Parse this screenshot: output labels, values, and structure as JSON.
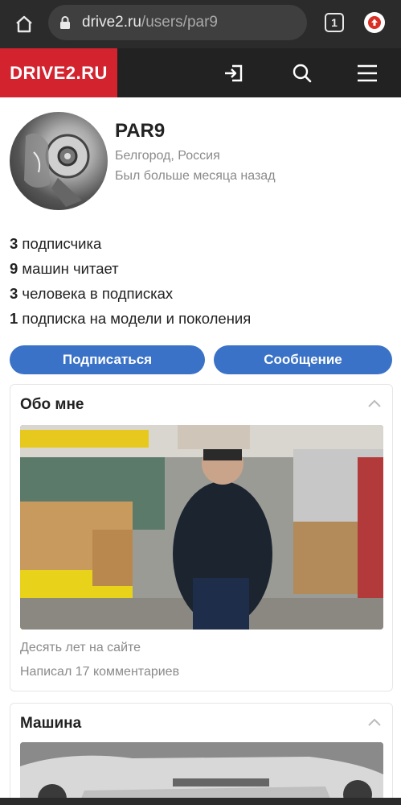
{
  "browser": {
    "url_domain": "drive2.ru",
    "url_path": "/users/par9",
    "tab_count": "1"
  },
  "site": {
    "logo": "DRIVE2.RU",
    "icons": [
      "login-icon",
      "search-icon",
      "menu-icon"
    ]
  },
  "profile": {
    "username": "PAR9",
    "location": "Белгород, Россия",
    "last_seen": "Был больше месяца назад"
  },
  "stats": [
    {
      "count": "3",
      "label": " подписчика"
    },
    {
      "count": "9",
      "label": " машин читает"
    },
    {
      "count": "3",
      "label": " человека в подписках"
    },
    {
      "count": "1",
      "label": " подписка на модели и поколения"
    }
  ],
  "actions": {
    "subscribe": "Подписаться",
    "message": "Сообщение"
  },
  "about": {
    "title": "Обо мне",
    "lines": [
      "Десять лет на сайте",
      "Написал 17 комментариев"
    ]
  },
  "car": {
    "title": "Машина"
  },
  "colors": {
    "brand_red": "#d3232f",
    "button_blue": "#3a72c7",
    "header_dark": "#222222"
  }
}
